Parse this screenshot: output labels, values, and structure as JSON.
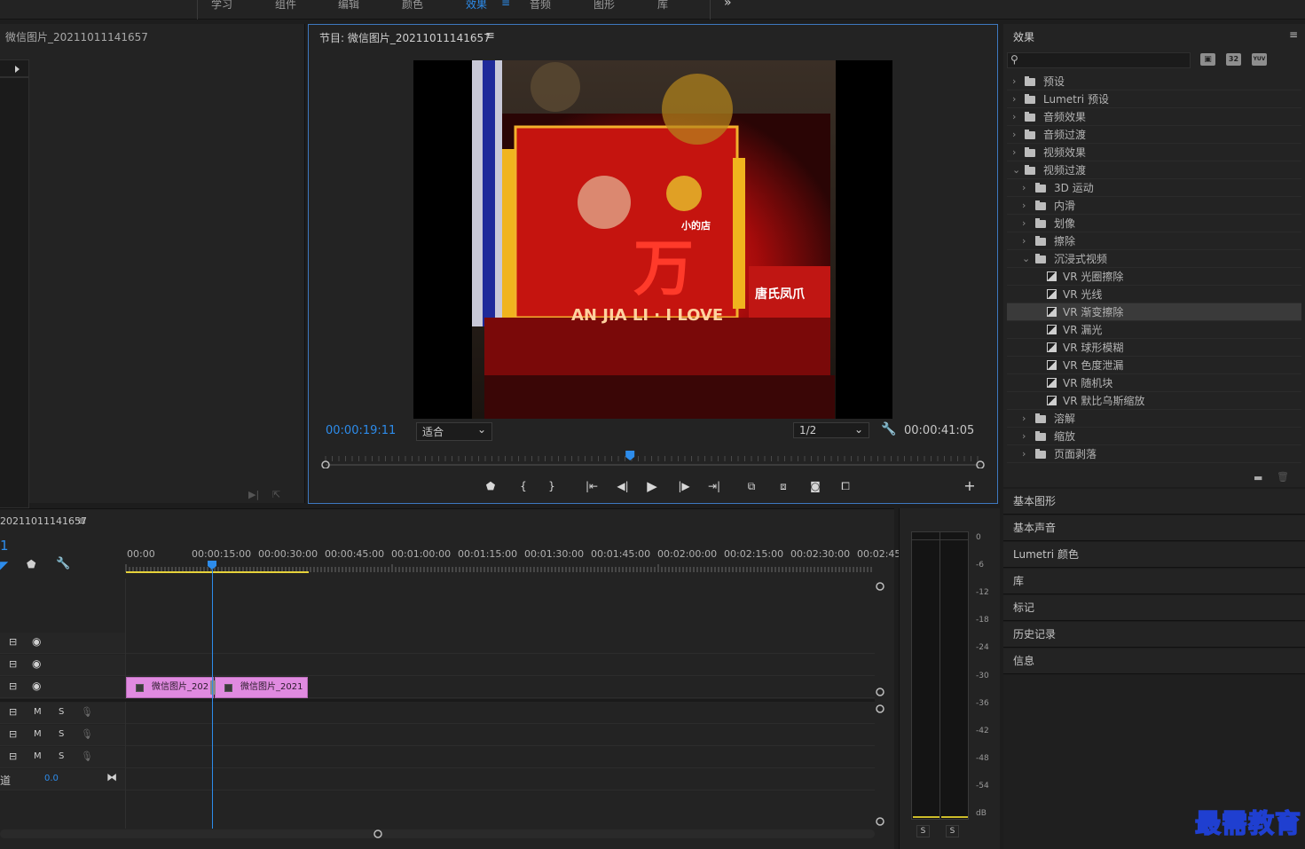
{
  "workspaces": {
    "tabs": [
      "学习",
      "组件",
      "编辑",
      "颜色",
      "效果",
      "音频",
      "图形",
      "库"
    ],
    "active": "效果",
    "overflow_icon": "double-chevron-right-icon"
  },
  "source": {
    "title": "微信图片_20211011141657"
  },
  "program": {
    "title": "节目: 微信图片_20211011141657",
    "menu_icon": "≡",
    "current_timecode": "00:00:19:11",
    "fit_label": "适合",
    "resolution_label": "1/2",
    "duration_timecode": "00:00:41:05",
    "video_sign_text": "AN JIA LI · I LOVE",
    "video_big_char": "万",
    "video_shop_sign": "唐氏凤爪",
    "video_story": "小的店",
    "playhead_fraction": 0.465
  },
  "effects": {
    "title": "效果",
    "menu_icon": "≡",
    "badges": [
      "32",
      "YUV"
    ],
    "tree": [
      {
        "label": "预设",
        "level": 0,
        "type": "folder-star",
        "open": false
      },
      {
        "label": "Lumetri 预设",
        "level": 0,
        "type": "folder-star",
        "open": false
      },
      {
        "label": "音频效果",
        "level": 0,
        "type": "folder",
        "open": false
      },
      {
        "label": "音频过渡",
        "level": 0,
        "type": "folder",
        "open": false
      },
      {
        "label": "视频效果",
        "level": 0,
        "type": "folder",
        "open": false
      },
      {
        "label": "视频过渡",
        "level": 0,
        "type": "folder",
        "open": true
      },
      {
        "label": "3D 运动",
        "level": 1,
        "type": "folder",
        "open": false
      },
      {
        "label": "内滑",
        "level": 1,
        "type": "folder",
        "open": false
      },
      {
        "label": "划像",
        "level": 1,
        "type": "folder",
        "open": false
      },
      {
        "label": "擦除",
        "level": 1,
        "type": "folder",
        "open": false
      },
      {
        "label": "沉浸式视频",
        "level": 1,
        "type": "folder",
        "open": true
      },
      {
        "label": "VR 光圈擦除",
        "level": 2,
        "type": "effect"
      },
      {
        "label": "VR 光线",
        "level": 2,
        "type": "effect"
      },
      {
        "label": "VR 渐变擦除",
        "level": 2,
        "type": "effect",
        "selected": true
      },
      {
        "label": "VR 漏光",
        "level": 2,
        "type": "effect"
      },
      {
        "label": "VR 球形模糊",
        "level": 2,
        "type": "effect"
      },
      {
        "label": "VR 色度泄漏",
        "level": 2,
        "type": "effect"
      },
      {
        "label": "VR 随机块",
        "level": 2,
        "type": "effect"
      },
      {
        "label": "VR 默比乌斯缩放",
        "level": 2,
        "type": "effect"
      },
      {
        "label": "溶解",
        "level": 1,
        "type": "folder",
        "open": false
      },
      {
        "label": "缩放",
        "level": 1,
        "type": "folder",
        "open": false
      },
      {
        "label": "页面剥落",
        "level": 1,
        "type": "folder",
        "open": false
      }
    ]
  },
  "side_panels": [
    "基本图形",
    "基本声音",
    "Lumetri 颜色",
    "库",
    "标记",
    "历史记录",
    "信息"
  ],
  "timeline": {
    "title": "20211011141657",
    "menu_icon": "≡",
    "sequence_number": "1",
    "ruler": [
      "00:00",
      "00:00:15:00",
      "00:00:30:00",
      "00:00:45:00",
      "00:01:00:00",
      "00:01:15:00",
      "00:01:30:00",
      "00:01:45:00",
      "00:02:00:00",
      "00:02:15:00",
      "00:02:30:00",
      "00:02:45:"
    ],
    "clips": [
      "微信图片_202",
      "微信图片_2021"
    ],
    "audio_buttons": {
      "mute": "M",
      "solo": "S"
    },
    "master_label": "道",
    "master_value": "0.0"
  },
  "meter": {
    "db_labels": [
      "0",
      "-6",
      "-12",
      "-18",
      "-24",
      "-30",
      "-36",
      "-42",
      "-48",
      "-54",
      "dB"
    ],
    "solo_buttons": [
      "S",
      "S"
    ]
  },
  "watermark": "最需教育",
  "colors": {
    "accent": "#2d8ceb",
    "clip": "#e08ae0",
    "panel": "#232323",
    "work_area": "#e6d23a"
  }
}
